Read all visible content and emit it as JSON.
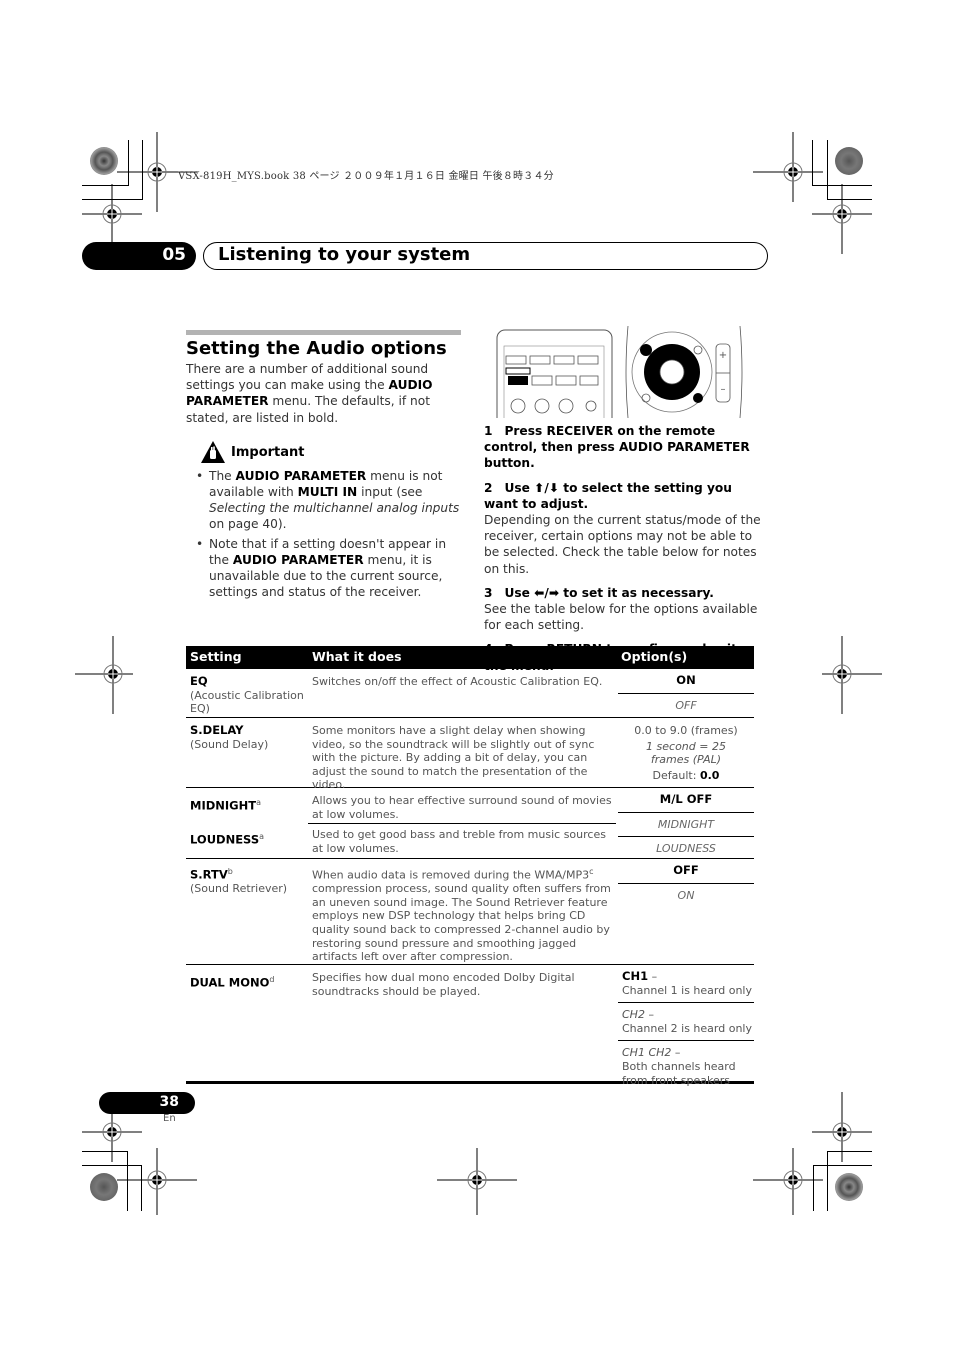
{
  "print_header": {
    "file_info": "VSX-819H_MYS.book  38 ページ  ２００９年１月１６日  金曜日  午後８時３４分"
  },
  "chapter": {
    "number": "05",
    "title": "Listening to your system"
  },
  "section": {
    "title": "Setting the Audio options",
    "intro_parts": {
      "p1": "There are a number of additional sound settings you can make using the ",
      "bold1": "AUDIO PARAMETER",
      "p2": " menu. The defaults, if not stated, are listed in bold."
    }
  },
  "important": {
    "label": "Important",
    "icon": "hand-warning-icon",
    "bullets": [
      {
        "t1": "The ",
        "b1": "AUDIO PARAMETER",
        "t2": " menu is not available with ",
        "b2": "MULTI IN",
        "t3": " input (see ",
        "i1": "Selecting the multichannel analog inputs",
        "t4": " on page 40)."
      },
      {
        "t1": "Note that if a setting doesn't appear in the ",
        "b1": "AUDIO PARAMETER",
        "t2": " menu, it is unavailable due to the current source, settings and status of the receiver."
      }
    ]
  },
  "steps": [
    {
      "num": "1",
      "heading": "Press RECEIVER on the remote control, then press AUDIO PARAMETER button.",
      "body": ""
    },
    {
      "num": "2",
      "heading_pre": "Use ",
      "arrows": "⬆/⬇",
      "heading_post": " to select the setting you want to adjust.",
      "body": "Depending on the current status/mode of the receiver, certain options may not be able to be selected. Check the table below for notes on this."
    },
    {
      "num": "3",
      "heading_pre": "Use ",
      "arrows": "⬅/➡",
      "heading_post": " to set it as necessary.",
      "body": "See the table below for the options available for each setting."
    },
    {
      "num": "4",
      "heading": "Press RETURN to confirm and exit the menu.",
      "body": ""
    }
  ],
  "table": {
    "headers": [
      "Setting",
      "What it does",
      "Option(s)"
    ],
    "rows": [
      {
        "name": "EQ",
        "sup": "",
        "sub": "(Acoustic Calibration EQ)",
        "desc": "Switches on/off the effect of Acoustic Calibration EQ.",
        "options": [
          {
            "text": "ON",
            "style": "bold"
          },
          {
            "text": "OFF",
            "style": "italic"
          }
        ]
      },
      {
        "name": "S.DELAY",
        "sup": "",
        "sub": "(Sound Delay)",
        "desc": "Some monitors have a slight delay when showing video, so the soundtrack will be slightly out of sync with the picture. By adding a bit of delay, you can adjust the sound to match the presentation of the video.",
        "options_text": {
          "range": "0.0 to 9.0 (frames)",
          "note": "1 second = 25 frames (PAL)",
          "default_label": "Default: ",
          "default_value": "0.0"
        }
      },
      {
        "name": "MIDNIGHT",
        "sup": "a",
        "sub": "",
        "desc": "Allows you to hear effective surround sound of movies at low volumes."
      },
      {
        "name": "LOUDNESS",
        "sup": "a",
        "sub": "",
        "desc": "Used to get good bass and treble from music sources at low volumes.",
        "shared_options": [
          {
            "text": "M/L OFF",
            "style": "bold"
          },
          {
            "text": "MIDNIGHT",
            "style": "italic"
          },
          {
            "text": "LOUDNESS",
            "style": "italic"
          }
        ]
      },
      {
        "name": "S.RTV",
        "sup": "b",
        "sub": "(Sound Retriever)",
        "desc_pre": "When audio data is removed during the WMA/MP3",
        "desc_sup": "c",
        "desc_post": " compression process, sound quality often suffers from an uneven sound image. The Sound Retriever feature employs new DSP technology that helps bring CD quality sound back to compressed 2-channel audio by restoring sound pressure and smoothing jagged artifacts left over after compression.",
        "options": [
          {
            "text": "OFF",
            "style": "bold"
          },
          {
            "text": "ON",
            "style": "italic"
          }
        ]
      },
      {
        "name": "DUAL MONO",
        "sup": "d",
        "sub": "",
        "desc": "Specifies how dual mono encoded Dolby Digital soundtracks should be played.",
        "options": [
          {
            "label": "CH1",
            "style": "bold",
            "dash": " –",
            "text": "Channel 1 is heard only"
          },
          {
            "label": "CH2",
            "style": "italic",
            "dash": " –",
            "text": "Channel 2 is heard only"
          },
          {
            "label": "CH1 CH2",
            "style": "italic",
            "dash": " –",
            "text": "Both channels heard from front speakers"
          }
        ]
      }
    ]
  },
  "footer": {
    "page_number": "38",
    "language": "En"
  }
}
